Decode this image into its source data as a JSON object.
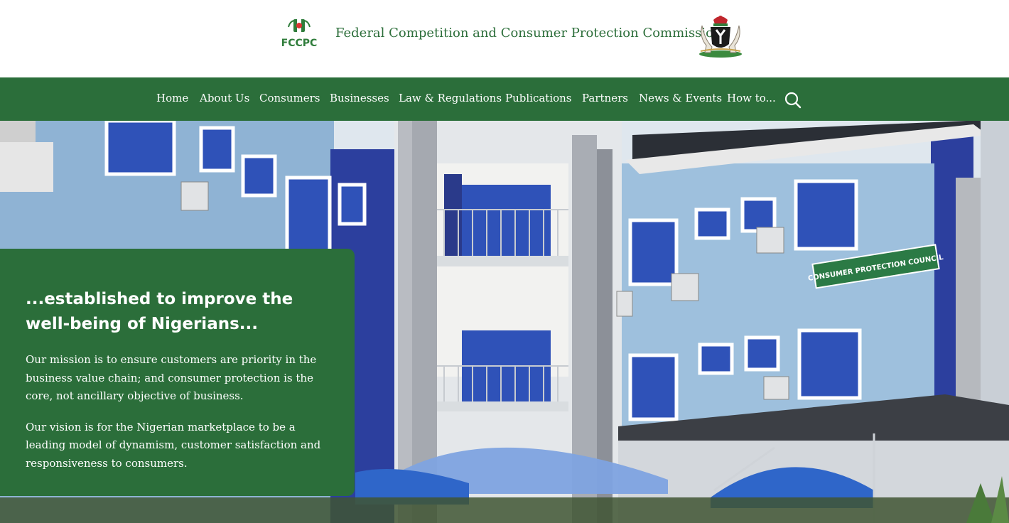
{
  "header": {
    "logo_text": "FCCPC",
    "site_title": "Federal Competition and Consumer Protection Commission"
  },
  "nav": {
    "items": [
      {
        "label": "Home"
      },
      {
        "label": "About Us"
      },
      {
        "label": "Consumers"
      },
      {
        "label": "Businesses"
      },
      {
        "label": "Law & Regulations"
      },
      {
        "label": "Publications"
      },
      {
        "label": "Partners"
      },
      {
        "label": "News & Events"
      },
      {
        "label": "How to..."
      }
    ],
    "search_icon": "search-icon"
  },
  "hero": {
    "building_sign": "CONSUMER PROTECTION COUNCIL",
    "heading": "...established to improve the well-being of Nigerians...",
    "mission": "Our mission is to ensure customers are priority in the business value chain; and consumer protection is the core, not ancillary objective of business.",
    "vision": "Our vision is for the Nigerian marketplace to be a leading model of dynamism, customer satisfaction and responsiveness to consumers."
  },
  "colors": {
    "brand_green": "#2b6e3a",
    "title_green": "#2c6e3a",
    "building_blue": "#8fb3d4"
  }
}
